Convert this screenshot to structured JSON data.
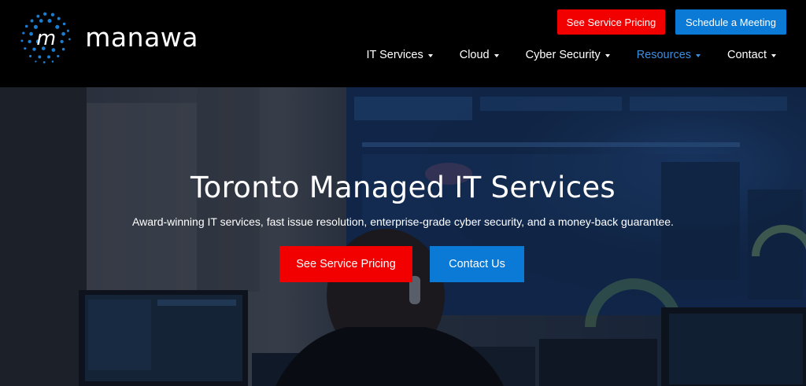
{
  "brand": {
    "name": "manawa",
    "logo_icon": "dotted-m-logo-icon",
    "accent": "#1a7fd4"
  },
  "header": {
    "pricing_button": "See Service Pricing",
    "meeting_button": "Schedule a Meeting",
    "nav": [
      {
        "label": "IT Services",
        "active": false
      },
      {
        "label": "Cloud",
        "active": false
      },
      {
        "label": "Cyber Security",
        "active": false
      },
      {
        "label": "Resources",
        "active": true
      },
      {
        "label": "Contact",
        "active": false
      }
    ]
  },
  "hero": {
    "title": "Toronto Managed IT Services",
    "subtitle": "Award-winning IT services, fast issue resolution, enterprise-grade cyber security, and a money-back guarantee.",
    "primary_button": "See Service Pricing",
    "secondary_button": "Contact Us"
  },
  "colors": {
    "red": "#f20000",
    "blue": "#0a7ad6",
    "active_nav": "#3d8fe0",
    "header_bg": "#000000"
  }
}
